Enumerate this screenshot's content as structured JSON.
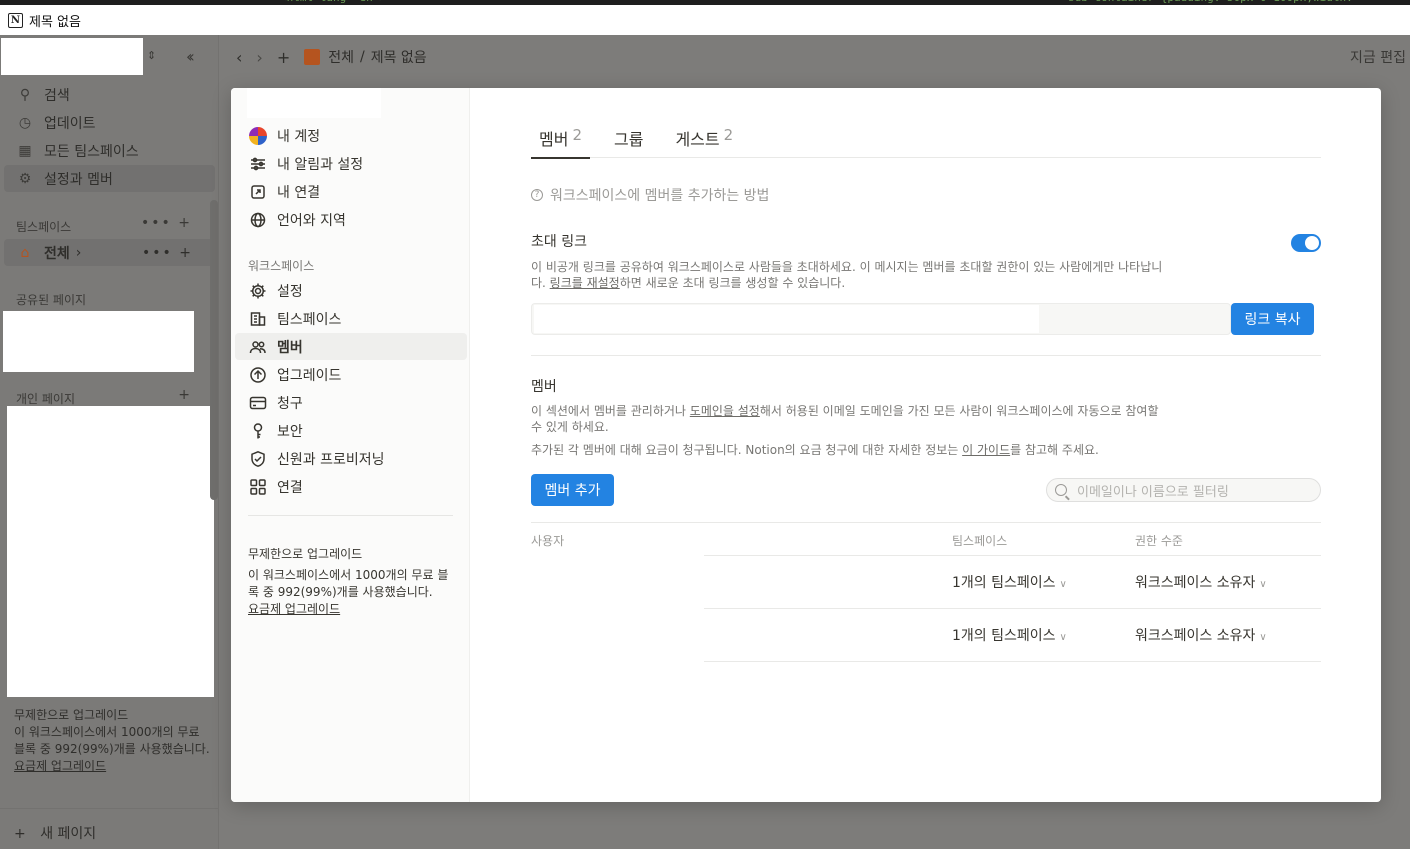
{
  "window": {
    "title": "제목 없음"
  },
  "sidebar": {
    "items": [
      {
        "label": "검색",
        "icon": "search-icon"
      },
      {
        "label": "업데이트",
        "icon": "clock-icon"
      },
      {
        "label": "모든 팀스페이스",
        "icon": "building-icon"
      },
      {
        "label": "설정과 멤버",
        "icon": "gear-icon"
      }
    ],
    "teamspaces_label": "팀스페이스",
    "teamspace_item": "전체",
    "shared_label": "공유된 페이지",
    "private_label": "개인 페이지",
    "upgrade": {
      "title": "무제한으로 업그레이드",
      "text": "이 워크스페이스에서 1000개의 무료 블록 중 992(99%)개를 사용했습니다.",
      "link": "요금제 업그레이드"
    },
    "new_page": "새 페이지"
  },
  "topbar": {
    "crumbs": [
      "전체",
      "제목 없음"
    ],
    "separator": "/",
    "edit_status": "지금 편집"
  },
  "modal": {
    "account_items": [
      {
        "label": "내 계정"
      },
      {
        "label": "내 알림과 설정"
      },
      {
        "label": "내 연결"
      },
      {
        "label": "언어와 지역"
      }
    ],
    "workspace_label": "워크스페이스",
    "workspace_items": [
      {
        "label": "설정"
      },
      {
        "label": "팀스페이스"
      },
      {
        "label": "멤버"
      },
      {
        "label": "업그레이드"
      },
      {
        "label": "청구"
      },
      {
        "label": "보안"
      },
      {
        "label": "신원과 프로비저닝"
      },
      {
        "label": "연결"
      }
    ],
    "upgrade": {
      "title": "무제한으로 업그레이드",
      "text": "이 워크스페이스에서 1000개의 무료 블록 중 992(99%)개를 사용했습니다.",
      "link": "요금제 업그레이드"
    },
    "tabs": [
      {
        "label": "멤버",
        "count": "2"
      },
      {
        "label": "그룹",
        "count": ""
      },
      {
        "label": "게스트",
        "count": "2"
      }
    ],
    "howto": "워크스페이스에 멤버를 추가하는 방법",
    "invite": {
      "title": "초대 링크",
      "desc1": "이 비공개 링크를 공유하여 워크스페이스로 사람들을 초대하세요. 이 메시지는 멤버를 초대할 권한이 있는 사람에게만 나타납니다. ",
      "desc_link": "링크를 재설정",
      "desc2": "하면 새로운 초대 링크를 생성할 수 있습니다.",
      "copy_button": "링크 복사",
      "enabled": true
    },
    "members": {
      "title": "멤버",
      "desc1a": "이 섹션에서 멤버를 관리하거나 ",
      "desc1_link": "도메인을 설정",
      "desc1b": "해서 허용된 이메일 도메인을 가진 모든 사람이 워크스페이스에 자동으로 참여할 수 있게 하세요.",
      "desc2a": "추가된 각 멤버에 대해 요금이 청구됩니다. Notion의 요금 청구에 대한 자세한 정보는 ",
      "desc2_link": "이 가이드",
      "desc2b": "를 참고해 주세요.",
      "add_button": "멤버 추가",
      "filter_placeholder": "이메일이나 이름으로 필터링",
      "columns": [
        "사용자",
        "팀스페이스",
        "권한 수준"
      ],
      "rows": [
        {
          "teamspaces": "1개의 팀스페이스",
          "role": "워크스페이스 소유자"
        },
        {
          "teamspaces": "1개의 팀스페이스",
          "role": "워크스페이스 소유자"
        }
      ]
    }
  },
  "colors": {
    "accent": "#2383e2",
    "text": "#37352f",
    "muted": "#9b9a97"
  }
}
